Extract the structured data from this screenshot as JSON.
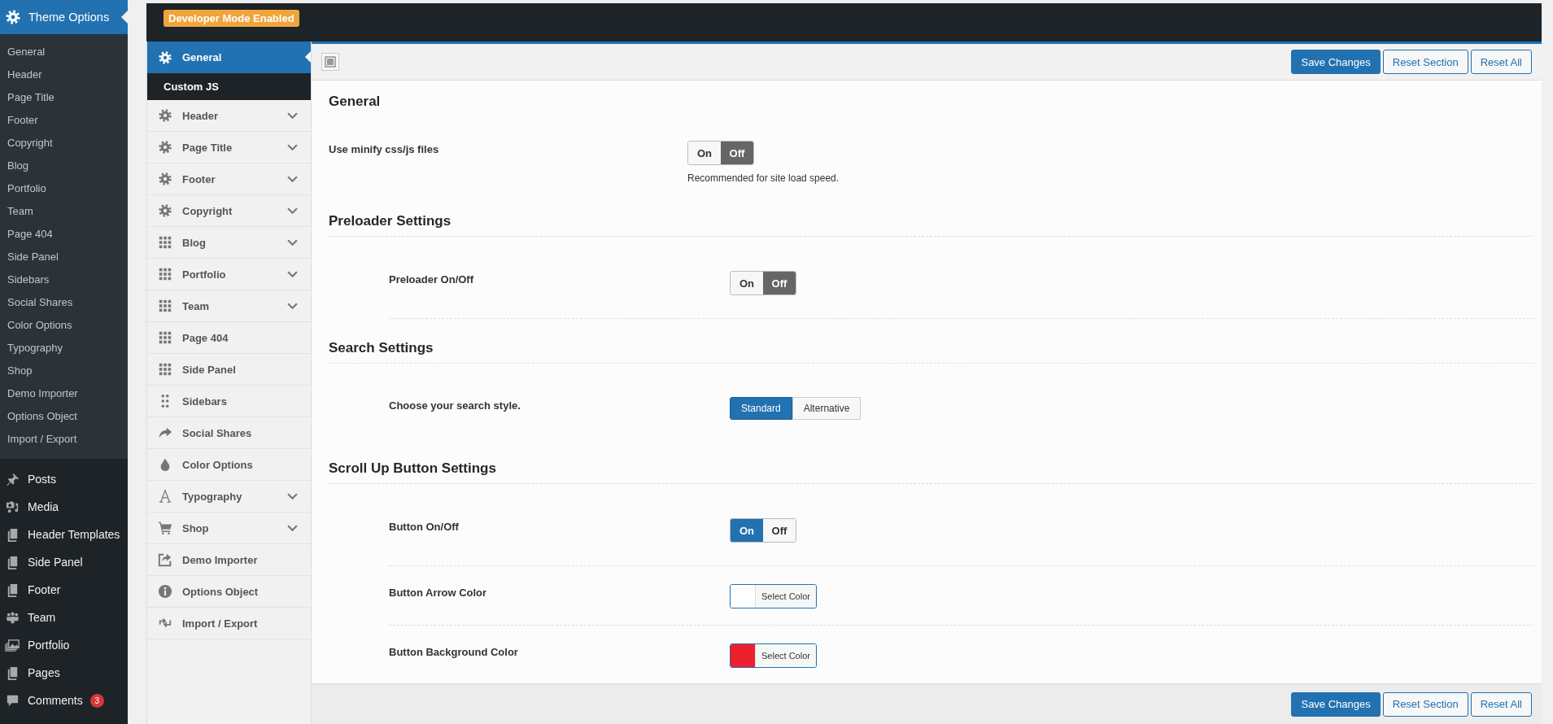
{
  "admin_menu": {
    "header": {
      "label": "Theme Options"
    },
    "submenu": [
      {
        "label": "General"
      },
      {
        "label": "Header"
      },
      {
        "label": "Page Title"
      },
      {
        "label": "Footer"
      },
      {
        "label": "Copyright"
      },
      {
        "label": "Blog"
      },
      {
        "label": "Portfolio"
      },
      {
        "label": "Team"
      },
      {
        "label": "Page 404"
      },
      {
        "label": "Side Panel"
      },
      {
        "label": "Sidebars"
      },
      {
        "label": "Social Shares"
      },
      {
        "label": "Color Options"
      },
      {
        "label": "Typography"
      },
      {
        "label": "Shop"
      },
      {
        "label": "Demo Importer"
      },
      {
        "label": "Options Object"
      },
      {
        "label": "Import / Export"
      }
    ],
    "items": [
      {
        "label": "Posts",
        "kind": "pin"
      },
      {
        "label": "Media",
        "kind": "media"
      },
      {
        "label": "Header Templates",
        "kind": "pages"
      },
      {
        "label": "Side Panel",
        "kind": "pages"
      },
      {
        "label": "Footer",
        "kind": "pages"
      },
      {
        "label": "Team",
        "kind": "team"
      },
      {
        "label": "Portfolio",
        "kind": "portfolio"
      },
      {
        "label": "Pages",
        "kind": "pages"
      },
      {
        "label": "Comments",
        "kind": "comment",
        "badge": "3"
      }
    ]
  },
  "top_bar": {
    "badge": "Developer Mode Enabled"
  },
  "options_nav": [
    {
      "label": "General",
      "kind": "gear",
      "selected": true,
      "expandable": false,
      "children": [
        {
          "label": "Custom JS"
        }
      ]
    },
    {
      "label": "Header",
      "kind": "gear",
      "selected": false,
      "expandable": true
    },
    {
      "label": "Page Title",
      "kind": "gear",
      "selected": false,
      "expandable": true
    },
    {
      "label": "Footer",
      "kind": "gear",
      "selected": false,
      "expandable": true
    },
    {
      "label": "Copyright",
      "kind": "gear",
      "selected": false,
      "expandable": true
    },
    {
      "label": "Blog",
      "kind": "grid",
      "selected": false,
      "expandable": true
    },
    {
      "label": "Portfolio",
      "kind": "grid",
      "selected": false,
      "expandable": true
    },
    {
      "label": "Team",
      "kind": "grid",
      "selected": false,
      "expandable": true
    },
    {
      "label": "Page 404",
      "kind": "grid",
      "selected": false,
      "expandable": false
    },
    {
      "label": "Side Panel",
      "kind": "grid",
      "selected": false,
      "expandable": false
    },
    {
      "label": "Sidebars",
      "kind": "dots",
      "selected": false,
      "expandable": false
    },
    {
      "label": "Social Shares",
      "kind": "share",
      "selected": false,
      "expandable": false
    },
    {
      "label": "Color Options",
      "kind": "drop",
      "selected": false,
      "expandable": false
    },
    {
      "label": "Typography",
      "kind": "font",
      "selected": false,
      "expandable": true
    },
    {
      "label": "Shop",
      "kind": "cart",
      "selected": false,
      "expandable": true
    },
    {
      "label": "Demo Importer",
      "kind": "import",
      "selected": false,
      "expandable": false
    },
    {
      "label": "Options Object",
      "kind": "info",
      "selected": false,
      "expandable": false
    },
    {
      "label": "Import / Export",
      "kind": "exchange",
      "selected": false,
      "expandable": false
    }
  ],
  "header_buttons": [
    {
      "label": "Save Changes",
      "kind": "primary"
    },
    {
      "label": "Reset Section",
      "kind": "secondary"
    },
    {
      "label": "Reset All",
      "kind": "secondary"
    }
  ],
  "sections": [
    {
      "title": "General",
      "kind": "plain",
      "fields": [
        {
          "kind": "switch",
          "label": "Use minify css/js files",
          "on_label": "On",
          "off_label": "Off",
          "on": false,
          "description": "Recommended for site load speed.",
          "divider": false
        }
      ]
    },
    {
      "title": "Preloader Settings",
      "kind": "group",
      "fields": [
        {
          "kind": "switch",
          "label": "Preloader On/Off",
          "on_label": "On",
          "off_label": "Off",
          "on": false,
          "divider": true
        }
      ]
    },
    {
      "title": "Search Settings",
      "kind": "group",
      "fields": [
        {
          "kind": "buttonset",
          "label": "Choose your search style.",
          "options": [
            {
              "label": "Standard",
              "selected": true
            },
            {
              "label": "Alternative",
              "selected": false
            }
          ],
          "divider": false
        }
      ]
    },
    {
      "title": "Scroll Up Button Settings",
      "kind": "group",
      "fields": [
        {
          "kind": "switch",
          "label": "Button On/Off",
          "on_label": "On",
          "off_label": "Off",
          "on": true,
          "divider": true
        },
        {
          "kind": "color",
          "label": "Button Arrow Color",
          "color": "#ffffff",
          "button": "Select Color",
          "divider": true
        },
        {
          "kind": "color",
          "label": "Button Background Color",
          "color": "#ee202e",
          "button": "Select Color",
          "divider": false
        }
      ]
    }
  ],
  "footer_buttons": [
    {
      "label": "Save Changes",
      "kind": "primary"
    },
    {
      "label": "Reset Section",
      "kind": "secondary"
    },
    {
      "label": "Reset All",
      "kind": "secondary"
    }
  ]
}
